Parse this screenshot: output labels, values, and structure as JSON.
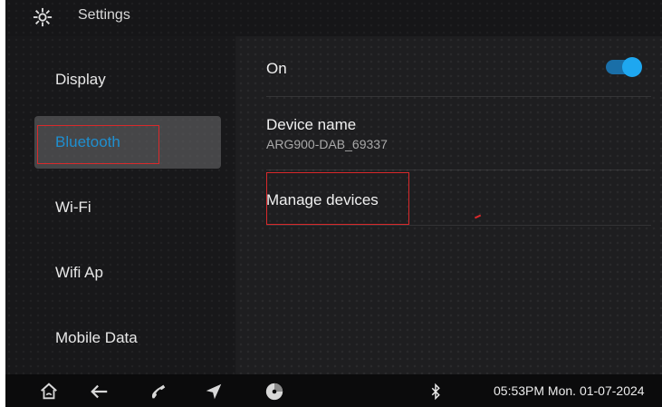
{
  "header": {
    "title": "Settings",
    "icon": "gear-icon"
  },
  "sidebar": {
    "selected_index": 1,
    "items": [
      {
        "label": "Display"
      },
      {
        "label": "Bluetooth"
      },
      {
        "label": "Wi-Fi"
      },
      {
        "label": "Wifi Ap"
      },
      {
        "label": "Mobile Data"
      }
    ]
  },
  "bluetooth": {
    "on_label": "On",
    "on_state": true,
    "device_name_label": "Device name",
    "device_name_value": "ARG900-DAB_69337",
    "manage_devices_label": "Manage devices"
  },
  "navbar": {
    "icons": [
      "home-icon",
      "back-icon",
      "phone-icon",
      "navigation-icon",
      "media-icon",
      "bluetooth-icon"
    ]
  },
  "status": {
    "datetime": "05:53PM Mon. 01-07-2024"
  },
  "colors": {
    "accent": "#1ea7f0",
    "selected_text": "#1f8fd0",
    "highlight_box": "#d9292b",
    "background": "#1e1e20"
  }
}
